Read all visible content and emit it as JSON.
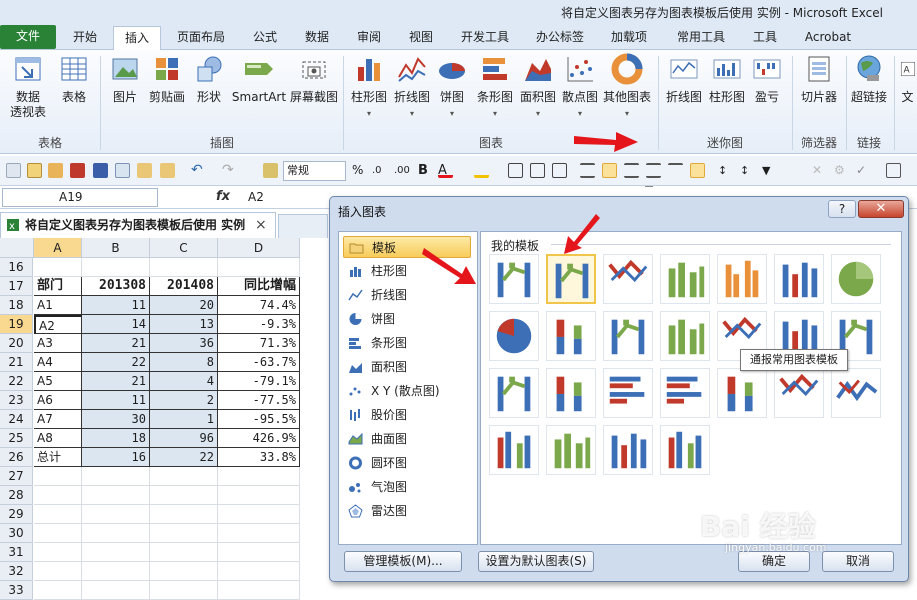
{
  "window": {
    "title": "将自定义图表另存为图表模板后使用 实例 - Microsoft Excel"
  },
  "tabs": [
    "文件",
    "开始",
    "插入",
    "页面布局",
    "公式",
    "数据",
    "审阅",
    "视图",
    "开发工具",
    "办公标签",
    "加载项",
    "常用工具",
    "工具",
    "Acrobat"
  ],
  "ribbon": {
    "buttons": {
      "pivot": {
        "l1": "数据",
        "l2": "透视表"
      },
      "table": "表格",
      "picture": "图片",
      "clipart": "剪贴画",
      "shapes": "形状",
      "smartart": "SmartArt",
      "screenshot": "屏幕截图",
      "bar": "柱形图",
      "line": "折线图",
      "pie": "饼图",
      "hbar": "条形图",
      "area": "面积图",
      "scatter": "散点图",
      "other": "其他图表",
      "sp_line": "折线图",
      "sp_col": "柱形图",
      "sp_wl": "盈亏",
      "slicer": "切片器",
      "hyperlink": "超链接",
      "text": "文"
    },
    "groups": {
      "tables": "表格",
      "illustrations": "插图",
      "charts": "图表",
      "sparklines": "迷你图",
      "filter": "筛选器",
      "links": "链接"
    }
  },
  "qat": {
    "number_format": "常规"
  },
  "formula_bar": {
    "name_box": "A19",
    "fx": "fx",
    "value": "A2"
  },
  "workbook_tab": {
    "title": "将自定义图表另存为图表模板后使用 实例",
    "close": "×"
  },
  "sheet": {
    "columns": [
      "A",
      "B",
      "C",
      "D"
    ],
    "rows": [
      {
        "n": "16",
        "cells": [
          "",
          "",
          "",
          ""
        ]
      },
      {
        "n": "17",
        "cells": [
          "部门",
          "201308",
          "201408",
          "同比增幅"
        ]
      },
      {
        "n": "18",
        "cells": [
          "A1",
          "11",
          "20",
          "74.4%"
        ]
      },
      {
        "n": "19",
        "cells": [
          "A2",
          "14",
          "13",
          "-9.3%"
        ]
      },
      {
        "n": "20",
        "cells": [
          "A3",
          "21",
          "36",
          "71.3%"
        ]
      },
      {
        "n": "21",
        "cells": [
          "A4",
          "22",
          "8",
          "-63.7%"
        ]
      },
      {
        "n": "22",
        "cells": [
          "A5",
          "21",
          "4",
          "-79.1%"
        ]
      },
      {
        "n": "23",
        "cells": [
          "A6",
          "11",
          "2",
          "-77.5%"
        ]
      },
      {
        "n": "24",
        "cells": [
          "A7",
          "30",
          "1",
          "-95.5%"
        ]
      },
      {
        "n": "25",
        "cells": [
          "A8",
          "18",
          "96",
          "426.9%"
        ]
      },
      {
        "n": "26",
        "cells": [
          "总计",
          "16",
          "22",
          "33.8%"
        ]
      },
      {
        "n": "27",
        "cells": [
          "",
          "",
          "",
          ""
        ]
      },
      {
        "n": "28",
        "cells": [
          "",
          "",
          "",
          ""
        ]
      },
      {
        "n": "29",
        "cells": [
          "",
          "",
          "",
          ""
        ]
      },
      {
        "n": "30",
        "cells": [
          "",
          "",
          "",
          ""
        ]
      },
      {
        "n": "31",
        "cells": [
          "",
          "",
          "",
          ""
        ]
      },
      {
        "n": "32",
        "cells": [
          "",
          "",
          "",
          ""
        ]
      },
      {
        "n": "33",
        "cells": [
          "",
          "",
          "",
          ""
        ]
      }
    ]
  },
  "dialog": {
    "title": "插入图表",
    "help": "?",
    "close": "✕",
    "categories": [
      "模板",
      "柱形图",
      "折线图",
      "饼图",
      "条形图",
      "面积图",
      "X Y (散点图)",
      "股价图",
      "曲面图",
      "圆环图",
      "气泡图",
      "雷达图"
    ],
    "templates_label": "我的模板",
    "tooltip": "通报常用图表模板",
    "buttons": {
      "manage": "管理模板(M)...",
      "set_default": "设置为默认图表(S)",
      "ok": "确定",
      "cancel": "取消"
    }
  },
  "colors": {
    "file_tab": "#2a8236",
    "accent_blue": "#3d6fb6",
    "accent_red": "#c0392b",
    "accent_green": "#7ba84a",
    "accent_orange": "#e8913a",
    "selected": "#f8cc5a",
    "arrow": "#e5161b"
  },
  "watermark": {
    "text": "Bai 经验",
    "sub": "jingyan.baidu.com"
  }
}
